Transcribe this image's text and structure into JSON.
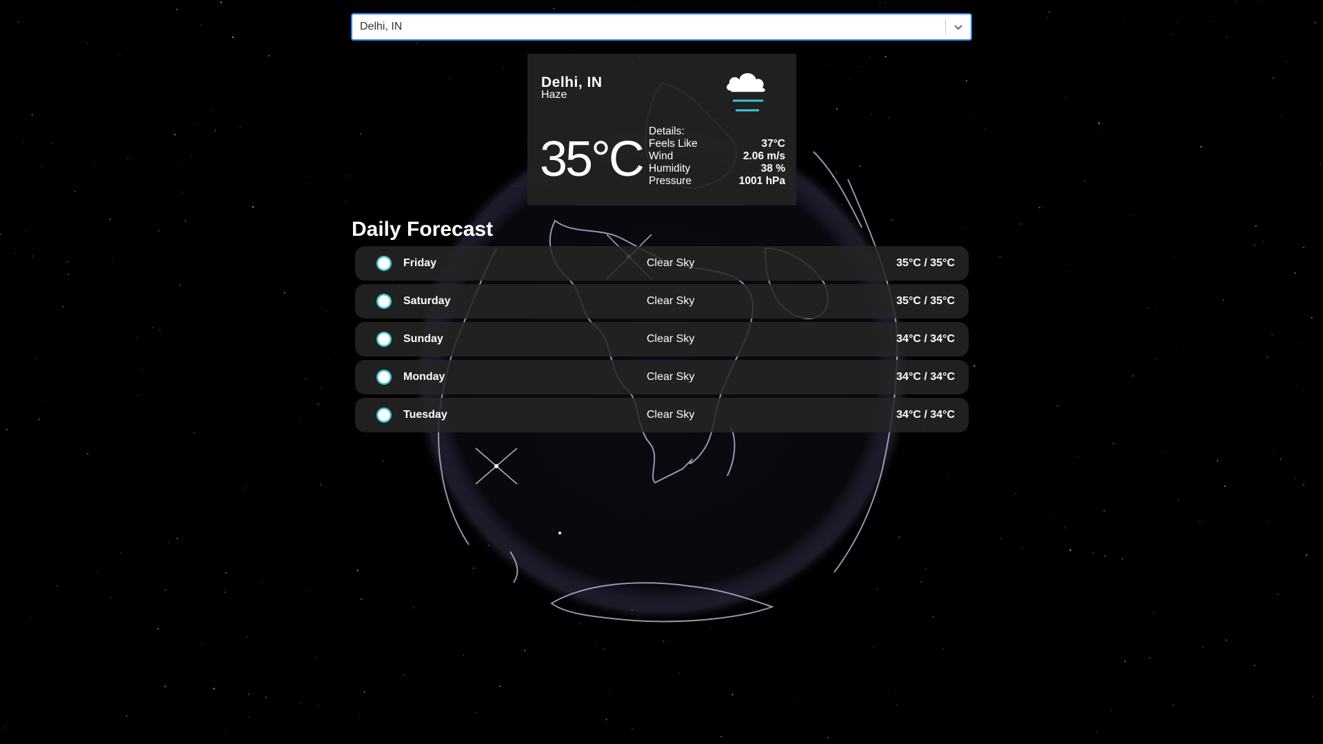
{
  "search": {
    "selected": "Delhi, IN",
    "icon": "chevron-down-icon"
  },
  "current": {
    "city": "Delhi, IN",
    "description": "Haze",
    "temperature": "35°C",
    "icon": "haze-cloud-icon",
    "details_label": "Details:",
    "details": [
      {
        "label": "Feels Like",
        "value": "37°C"
      },
      {
        "label": "Wind",
        "value": "2.06 m/s"
      },
      {
        "label": "Humidity",
        "value": "38 %"
      },
      {
        "label": "Pressure",
        "value": "1001 hPa"
      }
    ]
  },
  "forecast": {
    "title": "Daily Forecast",
    "days": [
      {
        "day": "Friday",
        "condition": "Clear Sky",
        "range": "35°C / 35°C",
        "icon": "sun-icon"
      },
      {
        "day": "Saturday",
        "condition": "Clear Sky",
        "range": "35°C / 35°C",
        "icon": "sun-icon"
      },
      {
        "day": "Sunday",
        "condition": "Clear Sky",
        "range": "34°C / 34°C",
        "icon": "sun-icon"
      },
      {
        "day": "Monday",
        "condition": "Clear Sky",
        "range": "34°C / 34°C",
        "icon": "sun-icon"
      },
      {
        "day": "Tuesday",
        "condition": "Clear Sky",
        "range": "34°C / 34°C",
        "icon": "sun-icon"
      }
    ]
  },
  "colors": {
    "accent": "#2684ff",
    "icon_cyan": "#3ec8d8",
    "card_bg": "#232323"
  }
}
